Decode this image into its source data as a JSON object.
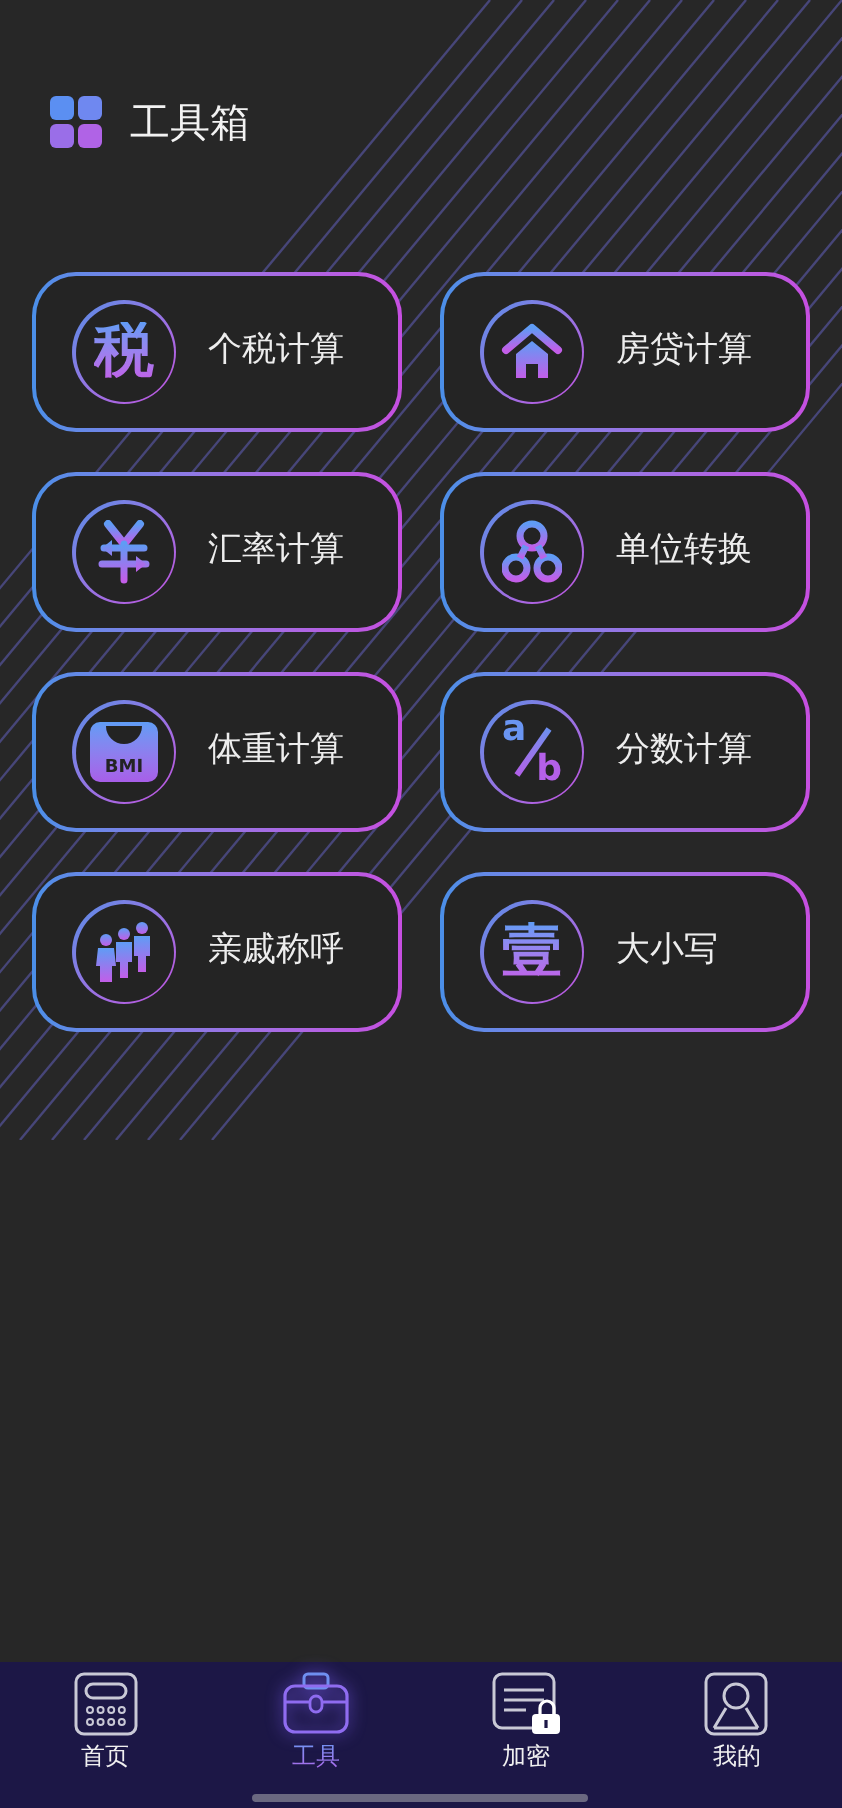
{
  "header": {
    "title": "工具箱"
  },
  "tools": [
    {
      "kind": "tax",
      "label": "个税计算",
      "glyphs": [
        "税"
      ]
    },
    {
      "kind": "house",
      "label": "房贷计算"
    },
    {
      "kind": "currency",
      "label": "汇率计算"
    },
    {
      "kind": "unit",
      "label": "单位转换"
    },
    {
      "kind": "bmi",
      "label": "体重计算",
      "glyphs": [
        "BMI"
      ]
    },
    {
      "kind": "fraction",
      "label": "分数计算",
      "glyphs": [
        "a",
        "b"
      ]
    },
    {
      "kind": "family",
      "label": "亲戚称呼"
    },
    {
      "kind": "capital",
      "label": "大小写",
      "glyphs": [
        "壹"
      ]
    }
  ],
  "tab_bar": [
    {
      "kind": "home",
      "label": "首页",
      "selected": false
    },
    {
      "kind": "tools",
      "label": "工具",
      "selected": true
    },
    {
      "kind": "encrypt",
      "label": "加密",
      "selected": false
    },
    {
      "kind": "mine",
      "label": "我的",
      "selected": false
    }
  ]
}
